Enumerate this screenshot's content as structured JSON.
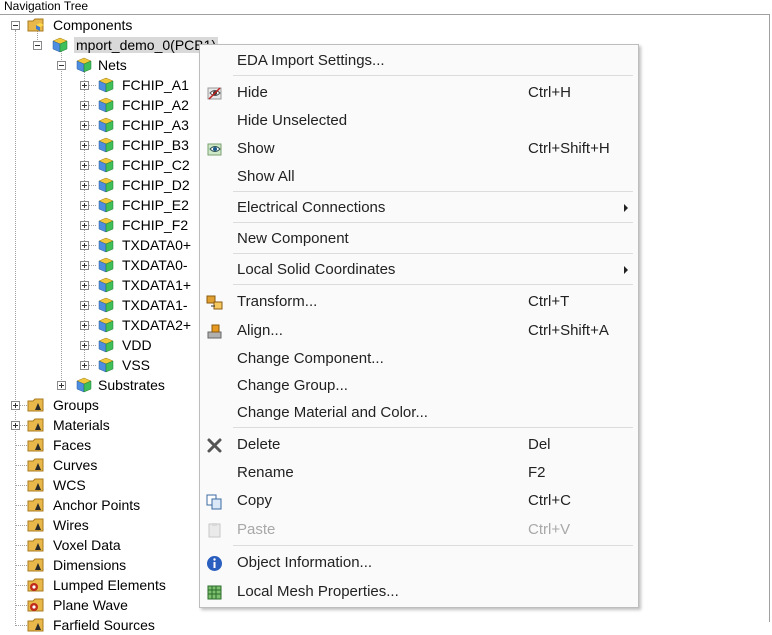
{
  "panel": {
    "title": "Navigation Tree"
  },
  "tree": {
    "components": "Components",
    "project": "mport_demo_0(PCB1)",
    "nets": "Nets",
    "net_items": [
      "FCHIP_A1",
      "FCHIP_A2",
      "FCHIP_A3",
      "FCHIP_B3",
      "FCHIP_C2",
      "FCHIP_D2",
      "FCHIP_E2",
      "FCHIP_F2",
      "TXDATA0+",
      "TXDATA0-",
      "TXDATA1+",
      "TXDATA1-",
      "TXDATA2+",
      "VDD",
      "VSS"
    ],
    "substrates": "Substrates",
    "root_items": [
      "Groups",
      "Materials",
      "Faces",
      "Curves",
      "WCS",
      "Anchor Points",
      "Wires",
      "Voxel Data",
      "Dimensions",
      "Lumped Elements",
      "Plane Wave",
      "Farfield Sources"
    ]
  },
  "menu": {
    "items": [
      {
        "label": "EDA Import Settings...",
        "shortcut": ""
      },
      {
        "label": "Hide",
        "shortcut": "Ctrl+H",
        "icon": "hide-icon"
      },
      {
        "label": "Hide Unselected",
        "shortcut": ""
      },
      {
        "label": "Show",
        "shortcut": "Ctrl+Shift+H",
        "icon": "show-icon"
      },
      {
        "label": "Show All",
        "shortcut": ""
      },
      {
        "label": "Electrical Connections",
        "shortcut": "",
        "submenu": true
      },
      {
        "label": "New Component",
        "shortcut": ""
      },
      {
        "label": "Local Solid Coordinates",
        "shortcut": "",
        "submenu": true
      },
      {
        "label": "Transform...",
        "shortcut": "Ctrl+T",
        "icon": "transform-icon"
      },
      {
        "label": "Align...",
        "shortcut": "Ctrl+Shift+A",
        "icon": "align-icon"
      },
      {
        "label": "Change Component...",
        "shortcut": ""
      },
      {
        "label": "Change Group...",
        "shortcut": ""
      },
      {
        "label": "Change Material and Color...",
        "shortcut": ""
      },
      {
        "label": "Delete",
        "shortcut": "Del",
        "icon": "delete-icon"
      },
      {
        "label": "Rename",
        "shortcut": "F2"
      },
      {
        "label": "Copy",
        "shortcut": "Ctrl+C",
        "icon": "copy-icon"
      },
      {
        "label": "Paste",
        "shortcut": "Ctrl+V",
        "icon": "paste-icon",
        "disabled": true
      },
      {
        "label": "Object Information...",
        "shortcut": "",
        "icon": "info-icon"
      },
      {
        "label": "Local Mesh Properties...",
        "shortcut": "",
        "icon": "mesh-icon"
      }
    ]
  }
}
